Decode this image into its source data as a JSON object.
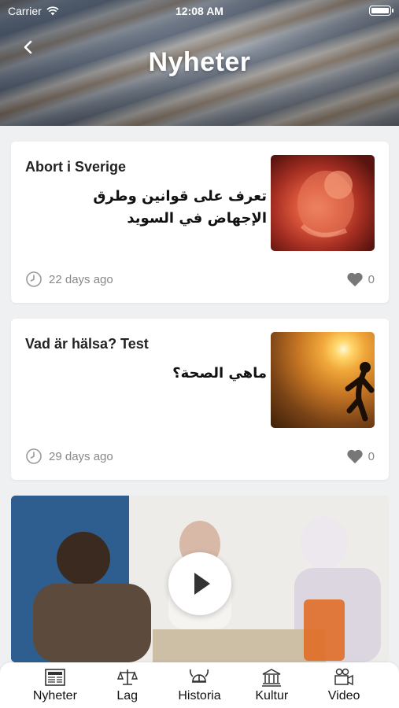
{
  "status_bar": {
    "carrier": "Carrier",
    "time": "12:08 AM"
  },
  "header": {
    "title": "Nyheter"
  },
  "articles": [
    {
      "title": "Abort i Sverige",
      "subtitle": "تعرف على قوانين وطرق الإجهاض في السويد",
      "date": "22 days ago",
      "likes": "0"
    },
    {
      "title": "Vad är hälsa? Test",
      "subtitle": "ماهي الصحة؟",
      "date": "29 days ago",
      "likes": "0"
    }
  ],
  "tabs": [
    {
      "label": "Nyheter",
      "icon": "newspaper-icon"
    },
    {
      "label": "Lag",
      "icon": "scales-icon"
    },
    {
      "label": "Historia",
      "icon": "viking-helmet-icon"
    },
    {
      "label": "Kultur",
      "icon": "museum-icon"
    },
    {
      "label": "Video",
      "icon": "video-camera-icon"
    }
  ],
  "colors": {
    "card_bg": "#ffffff",
    "page_bg": "#eef0f2",
    "muted_text": "#888888"
  }
}
